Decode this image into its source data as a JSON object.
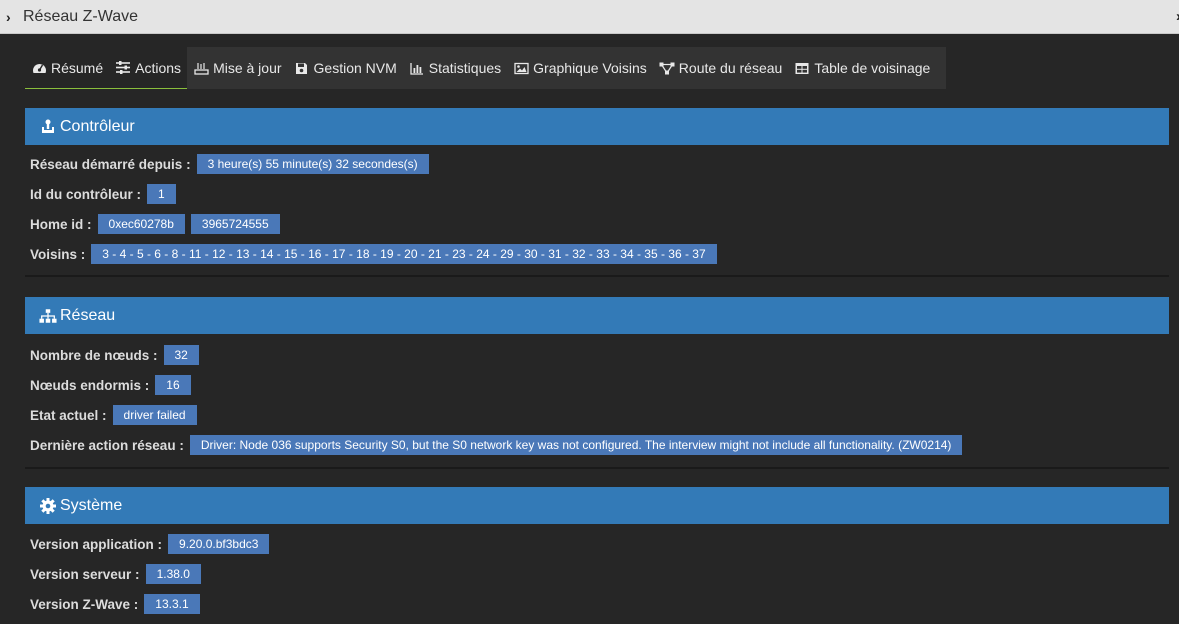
{
  "window": {
    "title": "Réseau Z-Wave"
  },
  "tabs": [
    {
      "label": "Résumé",
      "icon": "dashboard-icon"
    },
    {
      "label": "Actions",
      "icon": "sliders-icon"
    },
    {
      "label": "Mise à jour",
      "icon": "update-icon"
    },
    {
      "label": "Gestion NVM",
      "icon": "save-icon"
    },
    {
      "label": "Statistiques",
      "icon": "bar-chart-icon"
    },
    {
      "label": "Graphique Voisins",
      "icon": "image-icon"
    },
    {
      "label": "Route du réseau",
      "icon": "network-route-icon"
    },
    {
      "label": "Table de voisinage",
      "icon": "table-icon"
    }
  ],
  "controller": {
    "title": "Contrôleur",
    "started_label": "Réseau démarré depuis :",
    "started_value": "3 heure(s) 55 minute(s) 32 secondes(s)",
    "id_label": "Id du contrôleur :",
    "id_value": "1",
    "homeid_label": "Home id :",
    "homeid_hex": "0xec60278b",
    "homeid_dec": "3965724555",
    "neighbors_label": "Voisins :",
    "neighbors_value": "3 - 4 - 5 - 6 - 8 - 11 - 12 - 13 - 14 - 15 - 16 - 17 - 18 - 19 - 20 - 21 - 23 - 24 - 29 - 30 - 31 - 32 - 33 - 34 - 35 - 36 - 37"
  },
  "network": {
    "title": "Réseau",
    "nodes_label": "Nombre de nœuds :",
    "nodes_value": "32",
    "sleeping_label": "Nœuds endormis :",
    "sleeping_value": "16",
    "state_label": "Etat actuel :",
    "state_value": "driver failed",
    "last_action_label": "Dernière action réseau :",
    "last_action_value": "Driver: Node 036 supports Security S0, but the S0 network key was not configured. The interview might not include all functionality. (ZW0214)"
  },
  "system": {
    "title": "Système",
    "app_version_label": "Version application :",
    "app_version_value": "9.20.0.bf3bdc3",
    "server_version_label": "Version serveur :",
    "server_version_value": "1.38.0",
    "zwave_version_label": "Version Z-Wave :",
    "zwave_version_value": "13.3.1"
  },
  "colors": {
    "accent": "#337ab7",
    "badge": "#4a78b8",
    "active_tab_border": "#8abf3c"
  }
}
